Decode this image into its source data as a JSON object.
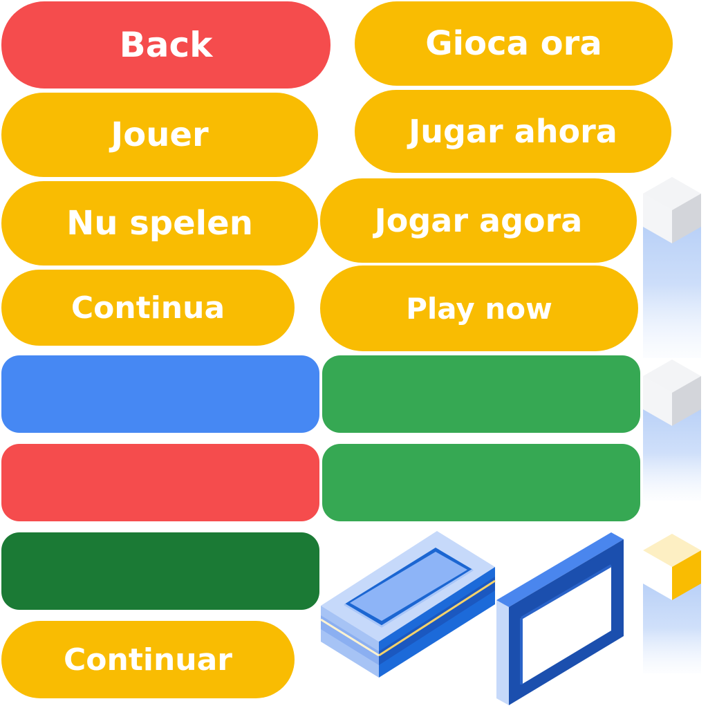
{
  "sheet": {
    "background": "#ffffff"
  },
  "colors": {
    "yellow": "#F9BC02",
    "red": "#F54C4D",
    "blue": "#4688F3",
    "green": "#36A853",
    "dark_green": "#1B7A35",
    "text": "#FFFFFF"
  },
  "labeled_buttons": [
    {
      "label": "Back",
      "color": "#F54C4D"
    },
    {
      "label": "Gioca ora",
      "color": "#F9BC02"
    },
    {
      "label": "Jouer",
      "color": "#F9BC02"
    },
    {
      "label": "Jugar ahora",
      "color": "#F9BC02"
    },
    {
      "label": "Nu spelen",
      "color": "#F9BC02"
    },
    {
      "label": "Jogar agora",
      "color": "#F9BC02"
    },
    {
      "label": "Continua",
      "color": "#F9BC02"
    },
    {
      "label": "Play now",
      "color": "#F9BC02"
    },
    {
      "label": "Continuar",
      "color": "#F9BC02"
    }
  ],
  "blank_buttons": [
    {
      "color": "#4688F3"
    },
    {
      "color": "#36A853"
    },
    {
      "color": "#F54C4D"
    },
    {
      "color": "#36A853"
    },
    {
      "color": "#1B7A35"
    }
  ],
  "sprites": [
    {
      "icon": "white-cube-pillar-icon"
    },
    {
      "icon": "white-cube-pillar-icon"
    },
    {
      "icon": "yellow-cube-pillar-icon"
    },
    {
      "icon": "isometric-blue-tray-icon"
    },
    {
      "icon": "isometric-blue-frame-icon"
    }
  ]
}
